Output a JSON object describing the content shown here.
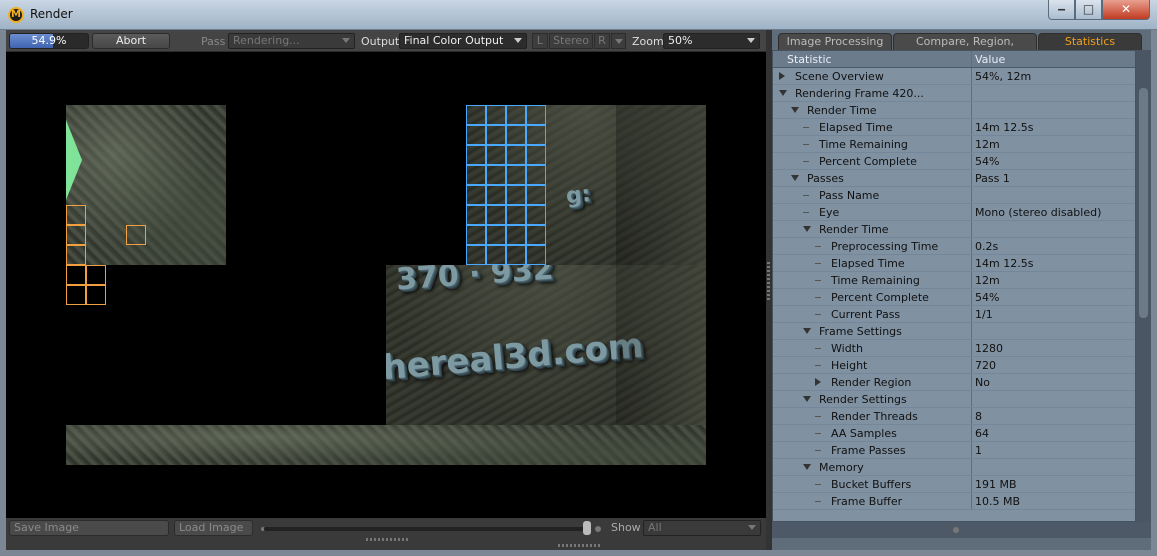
{
  "window": {
    "title": "Render"
  },
  "toolbar": {
    "progress_text": "54.9%",
    "progress_value": 0.549,
    "abort_label": "Abort",
    "pass_label": "Pass",
    "pass_value": "Rendering...",
    "output_label": "Output",
    "output_value": "Final Color Output",
    "left_eye": "L",
    "stereo_label": "Stereo",
    "right_eye": "R",
    "zoom_label": "Zoom",
    "zoom_value": "50%"
  },
  "viewport": {
    "render_text_1": "370 · 932",
    "render_text_2": "hereal3d.com",
    "render_text_3": "g:"
  },
  "bottombar": {
    "save_label": "Save Image",
    "load_label": "Load Image",
    "show_label": "Show",
    "show_value": "All"
  },
  "tabs": [
    "Image Processing",
    "Compare, Region, Options",
    "Statistics"
  ],
  "stats": {
    "header_statistic": "Statistic",
    "header_value": "Value",
    "rows": [
      {
        "name": "Scene Overview",
        "value": "54%, 12m",
        "depth": 0,
        "kind": "collapsed"
      },
      {
        "name": "Rendering Frame 420...",
        "value": "",
        "depth": 0,
        "kind": "expanded"
      },
      {
        "name": "Render Time",
        "value": "",
        "depth": 1,
        "kind": "expanded"
      },
      {
        "name": "Elapsed Time",
        "value": "14m 12.5s",
        "depth": 2,
        "kind": "leaf"
      },
      {
        "name": "Time Remaining",
        "value": "12m",
        "depth": 2,
        "kind": "leaf"
      },
      {
        "name": "Percent Complete",
        "value": "54%",
        "depth": 2,
        "kind": "leaf"
      },
      {
        "name": "Passes",
        "value": "Pass 1",
        "depth": 1,
        "kind": "expanded"
      },
      {
        "name": "Pass Name",
        "value": "",
        "depth": 2,
        "kind": "leaf"
      },
      {
        "name": "Eye",
        "value": "Mono (stereo disabled)",
        "depth": 2,
        "kind": "leaf"
      },
      {
        "name": "Render Time",
        "value": "",
        "depth": 2,
        "kind": "expanded"
      },
      {
        "name": "Preprocessing Time",
        "value": "0.2s",
        "depth": 3,
        "kind": "leaf"
      },
      {
        "name": "Elapsed Time",
        "value": "14m 12.5s",
        "depth": 3,
        "kind": "leaf"
      },
      {
        "name": "Time Remaining",
        "value": "12m",
        "depth": 3,
        "kind": "leaf"
      },
      {
        "name": "Percent Complete",
        "value": "54%",
        "depth": 3,
        "kind": "leaf"
      },
      {
        "name": "Current Pass",
        "value": "1/1",
        "depth": 3,
        "kind": "leaf"
      },
      {
        "name": "Frame Settings",
        "value": "",
        "depth": 2,
        "kind": "expanded"
      },
      {
        "name": "Width",
        "value": "1280",
        "depth": 3,
        "kind": "leaf"
      },
      {
        "name": "Height",
        "value": "720",
        "depth": 3,
        "kind": "leaf"
      },
      {
        "name": "Render Region",
        "value": "No",
        "depth": 3,
        "kind": "collapsed"
      },
      {
        "name": "Render Settings",
        "value": "",
        "depth": 2,
        "kind": "expanded"
      },
      {
        "name": "Render Threads",
        "value": "8",
        "depth": 3,
        "kind": "leaf"
      },
      {
        "name": "AA Samples",
        "value": "64",
        "depth": 3,
        "kind": "leaf"
      },
      {
        "name": "Frame Passes",
        "value": "1",
        "depth": 3,
        "kind": "leaf"
      },
      {
        "name": "Memory",
        "value": "",
        "depth": 2,
        "kind": "expanded"
      },
      {
        "name": "Bucket Buffers",
        "value": "191 MB",
        "depth": 3,
        "kind": "leaf"
      },
      {
        "name": "Frame Buffer",
        "value": "10.5 MB",
        "depth": 3,
        "kind": "leaf"
      }
    ]
  },
  "colors": {
    "accent": "#f0a020",
    "progress": "#4f74c4",
    "bucket_active": "#4aa8ff",
    "bucket_pending": "#f0a040"
  }
}
